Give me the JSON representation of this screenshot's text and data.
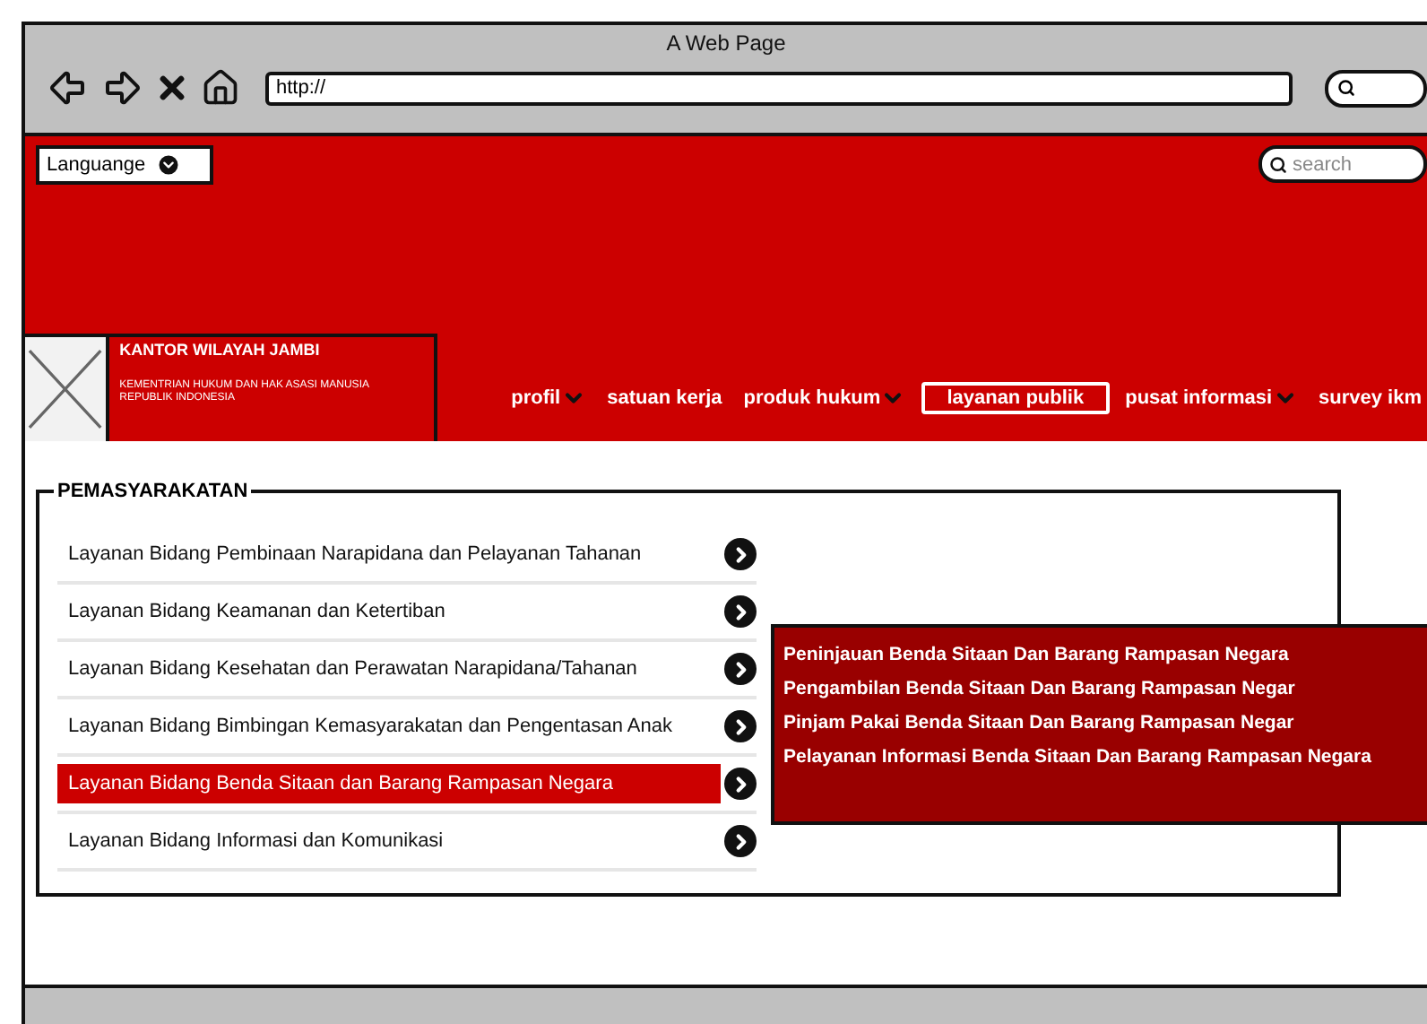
{
  "window": {
    "title": "A Web Page",
    "url": "http://"
  },
  "header": {
    "language": "Languange",
    "search_placeholder": "search",
    "org_name": "KANTOR WILAYAH JAMBI",
    "org_subtitle": "KEMENTRIAN HUKUM DAN HAK ASASI MANUSIA REPUBLIK INDONESIA"
  },
  "nav": [
    {
      "label": "profil",
      "dropdown": true,
      "selected": false
    },
    {
      "label": "satuan kerja",
      "dropdown": false,
      "selected": false
    },
    {
      "label": "produk hukum",
      "dropdown": true,
      "selected": false
    },
    {
      "label": "layanan publik",
      "dropdown": false,
      "selected": true
    },
    {
      "label": "pusat informasi",
      "dropdown": true,
      "selected": false
    },
    {
      "label": "survey ikm",
      "dropdown": false,
      "selected": false
    }
  ],
  "section": {
    "title": "PEMASYARAKATAN",
    "rows": [
      {
        "label": "Layanan Bidang Pembinaan Narapidana dan Pelayanan Tahanan",
        "selected": false
      },
      {
        "label": "Layanan Bidang Keamanan dan Ketertiban",
        "selected": false
      },
      {
        "label": "Layanan Bidang Kesehatan dan Perawatan Narapidana/Tahanan",
        "selected": false
      },
      {
        "label": "Layanan Bidang Bimbingan Kemasyarakatan dan Pengentasan Anak",
        "selected": false
      },
      {
        "label": "Layanan Bidang Benda Sitaan dan Barang Rampasan Negara",
        "selected": true
      },
      {
        "label": "Layanan Bidang Informasi dan Komunikasi",
        "selected": false
      }
    ]
  },
  "submenu": [
    "Peninjauan Benda Sitaan Dan Barang Rampasan Negara",
    "Pengambilan Benda Sitaan Dan Barang Rampasan Negar",
    "Pinjam Pakai Benda Sitaan Dan Barang Rampasan Negar",
    "Pelayanan Informasi Benda Sitaan Dan Barang Rampasan Negara"
  ]
}
